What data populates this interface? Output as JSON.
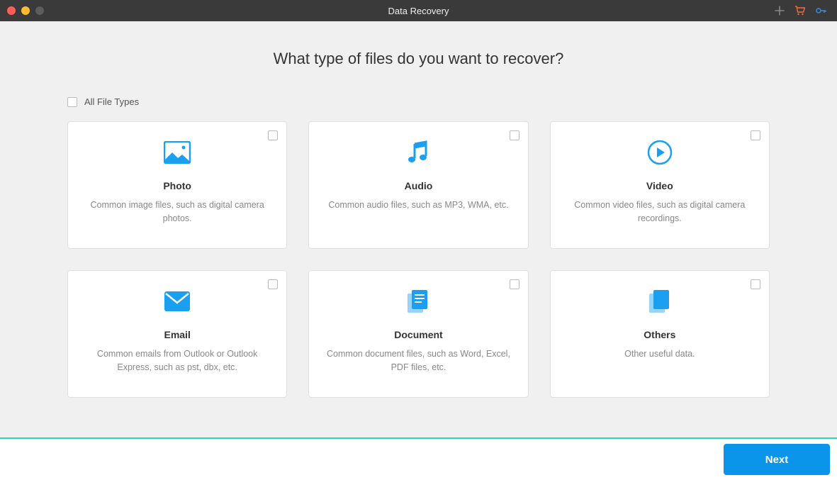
{
  "window": {
    "title": "Data Recovery"
  },
  "heading": "What type of files do you want to recover?",
  "all_files_label": "All File Types",
  "cards": [
    {
      "title": "Photo",
      "desc": "Common image files, such as digital camera photos."
    },
    {
      "title": "Audio",
      "desc": "Common audio files, such as MP3, WMA, etc."
    },
    {
      "title": "Video",
      "desc": "Common video files, such as digital camera recordings."
    },
    {
      "title": "Email",
      "desc": "Common emails from Outlook or Outlook Express, such as pst, dbx, etc."
    },
    {
      "title": "Document",
      "desc": "Common document files, such as Word, Excel, PDF files, etc."
    },
    {
      "title": "Others",
      "desc": "Other useful data."
    }
  ],
  "footer": {
    "next_label": "Next"
  },
  "colors": {
    "accent": "#0a94ea",
    "teal": "#1fd8c6",
    "orange": "#f06e3c",
    "cart": "#f06e3c",
    "key": "#3a8ad8"
  }
}
